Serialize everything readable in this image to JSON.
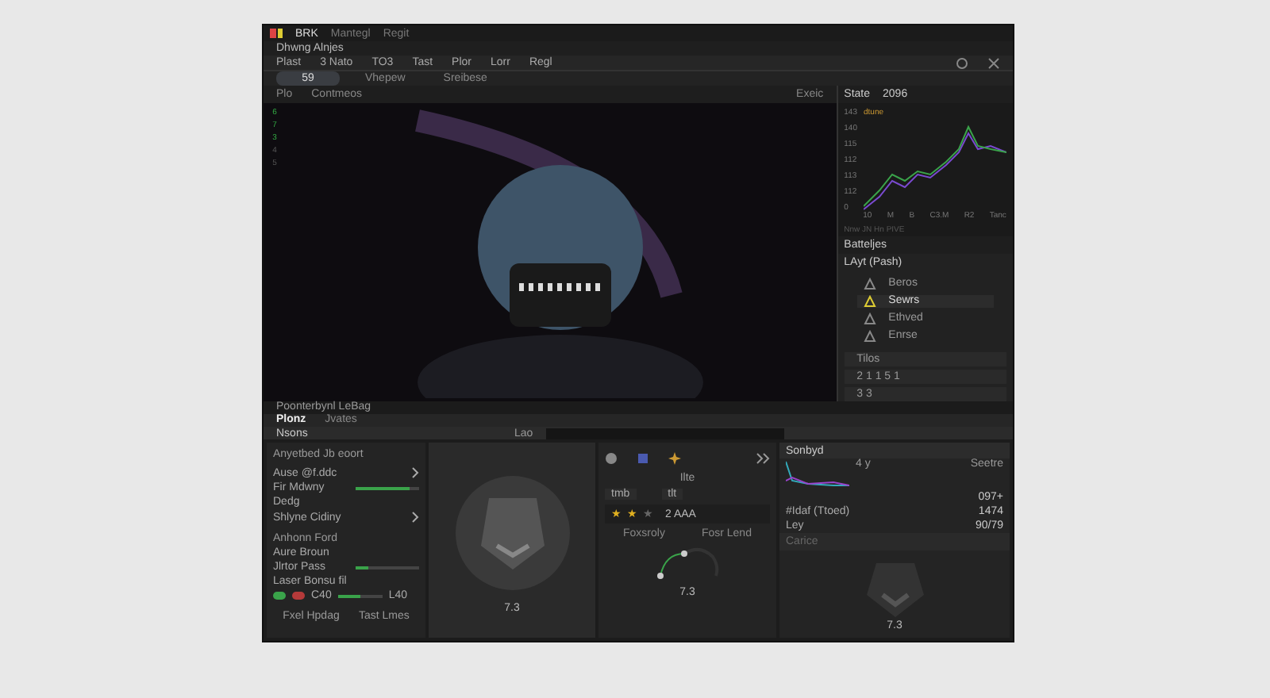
{
  "window": {
    "title": "BRK",
    "subtitle": "Mantegl",
    "extra": "Regit"
  },
  "menu_title": "Dhwng Alnjes",
  "toolbar": [
    "Plast",
    "3 Nato",
    "TO3",
    "Tast",
    "Plor",
    "Lorr",
    "Regl"
  ],
  "tabs": [
    {
      "label": "59",
      "selected": true
    },
    {
      "label": "Vhepew",
      "selected": false
    },
    {
      "label": "Sreibese",
      "selected": false
    }
  ],
  "canvas_bar": {
    "items": [
      "Plo",
      "Contmeos"
    ],
    "right": "Exeic"
  },
  "gutter": [
    "6",
    "7",
    "3",
    "4",
    "5"
  ],
  "chart_panel": {
    "title": "State",
    "value": "2096",
    "legend": "dtune",
    "y_labels": [
      "143",
      "140",
      "115",
      "112",
      "113",
      "112",
      "0"
    ],
    "x_labels": [
      "10",
      "M",
      "B",
      "C3.M",
      "R2",
      "Tanc"
    ],
    "footer": "Nnw JN Hn  PIVE"
  },
  "layers": {
    "title": "Batteljes",
    "selected_item": "LAyt (Pash)",
    "items": [
      {
        "label": "Beros",
        "selected": false
      },
      {
        "label": "Sewrs",
        "selected": true
      },
      {
        "label": "Ethved",
        "selected": false
      },
      {
        "label": "Enrse",
        "selected": false
      }
    ],
    "dropdowns": [
      "Tilos",
      "2 1 1 5 1",
      "3 3"
    ]
  },
  "status": "Poonterbynl LeBag",
  "bottom_tabs": [
    {
      "label": "Plonz",
      "selected": true
    },
    {
      "label": "Jvates",
      "selected": false
    }
  ],
  "section": {
    "title": "Nsons",
    "field_label": "Lao"
  },
  "props": {
    "heading1": "Anyetbed Jb eoort",
    "rows1": [
      {
        "kind": "arrow",
        "label": "Ause @f.ddc"
      },
      {
        "kind": "slider",
        "label": "Fir Mdwny",
        "level": 0.85
      },
      {
        "kind": "plain",
        "label": "Dedg"
      },
      {
        "kind": "arrow",
        "label": "Shlyne Cidiny"
      }
    ],
    "heading2": "Anhonn Ford",
    "rows2": [
      {
        "kind": "plain",
        "label": "Aure Broun"
      },
      {
        "kind": "slider",
        "label": "Jlrtor Pass",
        "level": 0.2
      },
      {
        "kind": "plain",
        "label": "Laser Bonsu fil"
      }
    ],
    "color_row": {
      "swatches": [
        {
          "color": "#3aa34a"
        },
        {
          "color": "#b53a3a"
        }
      ],
      "value": "C40",
      "level": 0.5,
      "reading": "L40"
    },
    "footer": [
      "Fxel Hpdag",
      "Tast Lmes"
    ]
  },
  "preview_label": "7.3",
  "tools": {
    "caption": "Ilte",
    "buttons": [
      "tmb",
      "tlt"
    ],
    "stars": 2,
    "rating": "2 AAA",
    "labels": [
      "Foxsroly",
      "Fosr Lend"
    ],
    "curve_label": "7.3"
  },
  "sound": {
    "title": "Sonbyd",
    "column": "Seetre",
    "tag": "4 y",
    "rows": [
      {
        "name": "",
        "value": "097+"
      },
      {
        "name": "#Idaf (Ttoed)",
        "value": "1474"
      },
      {
        "name": "Ley",
        "value": "90/79"
      }
    ],
    "caption": "Carice",
    "image_label": "7.3"
  }
}
